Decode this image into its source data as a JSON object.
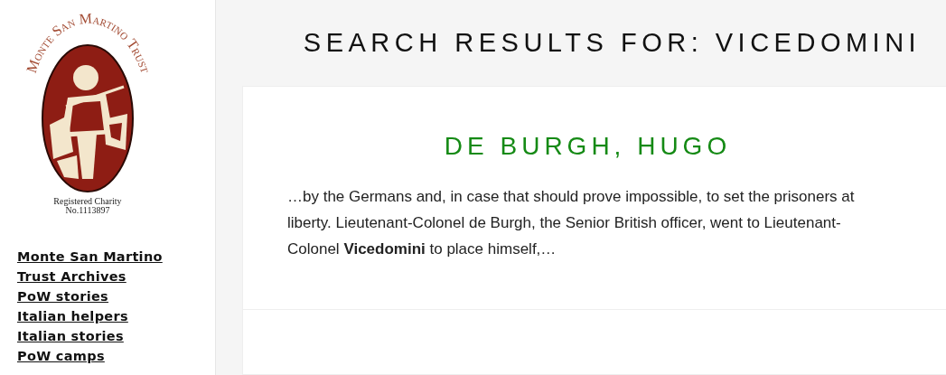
{
  "logo": {
    "name": "Monte San Martino Trust",
    "registration": [
      "Registered Charity",
      "No.1113897"
    ]
  },
  "nav": [
    {
      "label": "Monte San Martino"
    },
    {
      "label": "Trust Archives"
    },
    {
      "label": "PoW stories"
    },
    {
      "label": "Italian helpers"
    },
    {
      "label": "Italian stories"
    },
    {
      "label": "PoW camps"
    }
  ],
  "page_title": "SEARCH RESULTS FOR: VICEDOMINI",
  "results": [
    {
      "title": "DE BURGH, HUGO",
      "excerpt": "…by the Germans and, in case that should prove impossible, to set the prisoners at liberty. Lieutenant-Colonel de Burgh, the Senior British officer, went to Lieutenant-Colonel **Vicedomini** to place himself,…"
    }
  ]
}
